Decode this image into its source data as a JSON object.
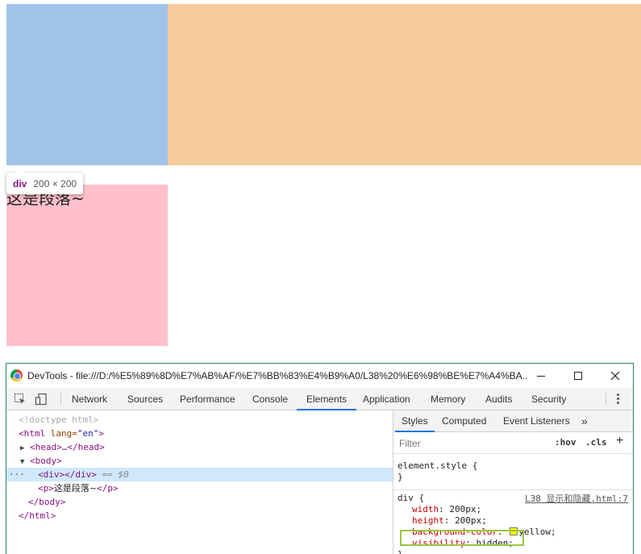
{
  "page": {
    "paragraph_text": "这是段落~",
    "colors": {
      "blue_box": "#a0c4e8",
      "orange_box": "#f7cc9c",
      "pink_box": "#ffc0cb"
    }
  },
  "tooltip": {
    "tag": "div",
    "dims": "200 × 200"
  },
  "devtools": {
    "title": "DevTools - file:///D:/%E5%89%8D%E7%AB%AF/%E7%BB%83%E4%B9%A0/L38%20%E6%98%BE%E7%A4%BA...",
    "tabs": [
      "Network",
      "Sources",
      "Performance",
      "Console",
      "Elements",
      "Application",
      "Memory",
      "Audits",
      "Security"
    ],
    "active_tab": "Elements",
    "dom": {
      "doctype": "<!doctype html>",
      "html_open_tag": "<html",
      "html_attr_name": " lang=",
      "html_attr_value": "\"en\"",
      "html_open_close": ">",
      "head": "<head>…</head>",
      "body_open": "<body>",
      "div_line": "<div></div>",
      "selected_marker": "== $0",
      "p_open": "<p>",
      "p_text": "这是段落~",
      "p_close": "</p>",
      "body_close": "</body>",
      "html_close": "</html>",
      "ellipsis": "···"
    },
    "styles": {
      "tabs": [
        "Styles",
        "Computed",
        "Event Listeners",
        "»"
      ],
      "filter_placeholder": "Filter",
      "hov": ":hov",
      "cls": ".cls",
      "plus": "+",
      "element_style_open": "element.style {",
      "brace_close": "}",
      "rule_selector": "div {",
      "rule_source": "L38 显示和隐藏.html:7",
      "declarations": [
        {
          "prop": "width",
          "value": "200px;"
        },
        {
          "prop": "height",
          "value": "200px;"
        },
        {
          "prop": "background-color",
          "value": "yellow;"
        },
        {
          "prop": "visibility",
          "value": "hidden;"
        }
      ]
    }
  }
}
